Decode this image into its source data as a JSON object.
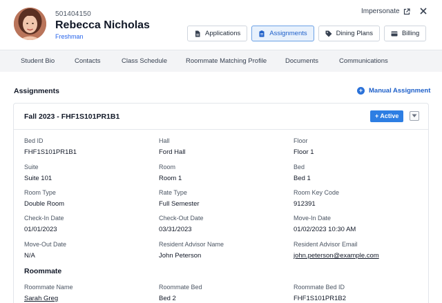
{
  "student": {
    "id": "501404150",
    "name": "Rebecca Nicholas",
    "level": "Freshman"
  },
  "header": {
    "impersonate_label": "Impersonate",
    "buttons": [
      {
        "label": "Applications",
        "icon": "document-icon"
      },
      {
        "label": "Assignments",
        "icon": "clipboard-icon",
        "active": true
      },
      {
        "label": "Dining Plans",
        "icon": "tag-icon"
      },
      {
        "label": "Billing",
        "icon": "card-icon"
      }
    ]
  },
  "tabs": [
    "Student Bio",
    "Contacts",
    "Class Schedule",
    "Roommate Matching Profile",
    "Documents",
    "Communications"
  ],
  "assignments": {
    "title": "Assignments",
    "manual_label": "Manual Assignment",
    "card": {
      "title": "Fall 2023 - FHF1S101PR1B1",
      "status": "+ Active",
      "fields": [
        {
          "label": "Bed ID",
          "value": "FHF1S101PR1B1"
        },
        {
          "label": "Hall",
          "value": "Ford Hall"
        },
        {
          "label": "Floor",
          "value": "Floor 1"
        },
        {
          "label": "Suite",
          "value": "Suite 101"
        },
        {
          "label": "Room",
          "value": "Room 1"
        },
        {
          "label": "Bed",
          "value": "Bed 1"
        },
        {
          "label": "Room Type",
          "value": "Double Room"
        },
        {
          "label": "Rate Type",
          "value": "Full Semester"
        },
        {
          "label": "Room Key Code",
          "value": "912391"
        },
        {
          "label": "Check-In Date",
          "value": "01/01/2023"
        },
        {
          "label": "Check-Out Date",
          "value": "03/31/2023"
        },
        {
          "label": "Move-In Date",
          "value": "01/02/2023 10:30 AM"
        },
        {
          "label": "Move-Out Date",
          "value": "N/A"
        },
        {
          "label": "Resident Advisor Name",
          "value": "John Peterson"
        },
        {
          "label": "Resident Advisor Email",
          "value": "john.peterson@example.com"
        }
      ],
      "roommate_title": "Roommate",
      "roommate_fields": [
        {
          "label": "Roommate Name",
          "value": "Sarah Greg"
        },
        {
          "label": "Roommate Bed",
          "value": "Bed 2"
        },
        {
          "label": "Roommate Bed ID",
          "value": "FHF1S101PR1B2"
        }
      ]
    }
  }
}
